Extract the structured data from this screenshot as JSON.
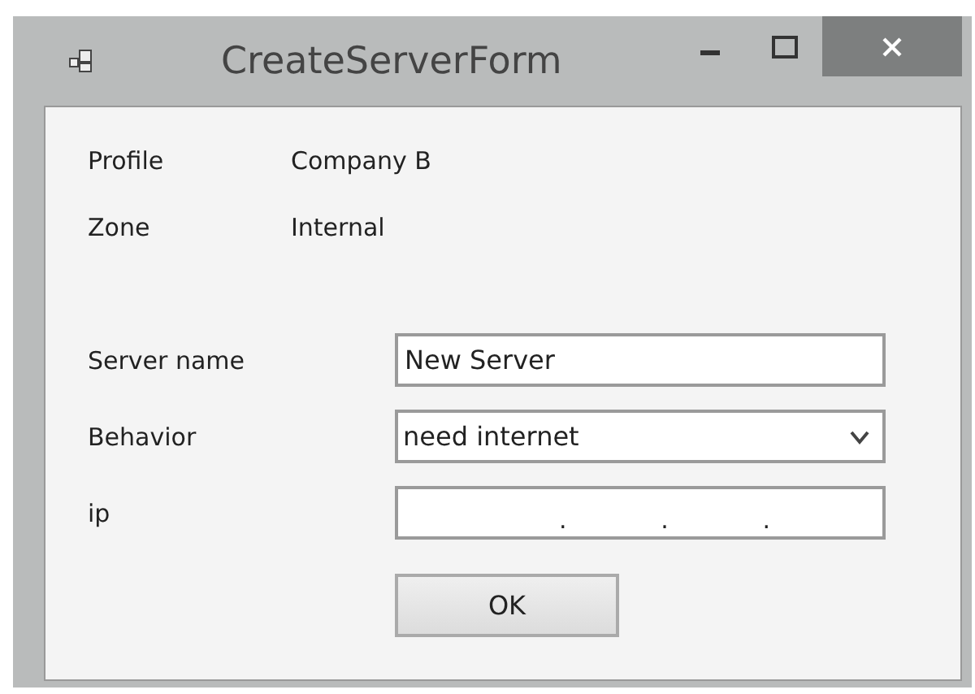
{
  "window": {
    "title": "CreateServerForm"
  },
  "info": [
    {
      "label": "Profile",
      "value": "Company B"
    },
    {
      "label": "Zone",
      "value": "Internal"
    }
  ],
  "fields": [
    {
      "kind": "text",
      "label": "Server name",
      "value": "New Server"
    },
    {
      "kind": "dropdown",
      "label": "Behavior",
      "value": "need internet"
    },
    {
      "kind": "ip",
      "label": "ip",
      "separators": [
        ".",
        ".",
        "."
      ]
    }
  ],
  "buttons": [
    "OK"
  ]
}
